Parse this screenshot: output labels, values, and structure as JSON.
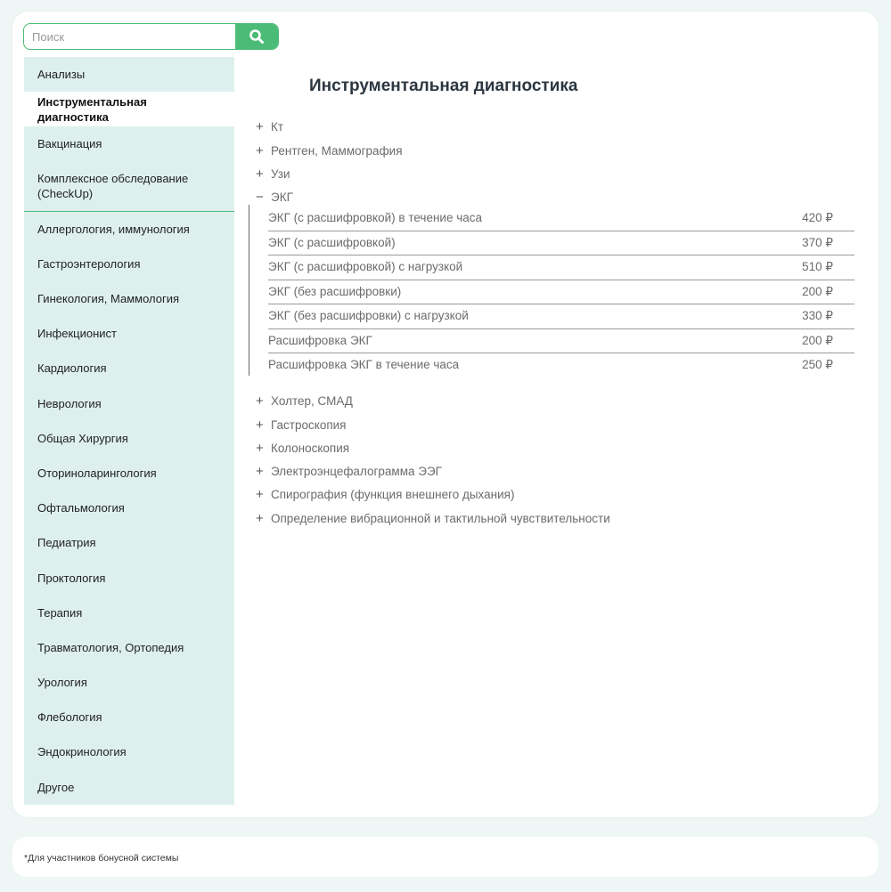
{
  "search": {
    "placeholder": "Поиск"
  },
  "sidebar": {
    "items": [
      {
        "label": "Анализы"
      },
      {
        "label": "Инструментальная диагностика"
      },
      {
        "label": "Вакцинация"
      },
      {
        "label": "Комплексное обследование (CheckUp)"
      },
      {
        "label": "Аллергология, иммунология"
      },
      {
        "label": "Гастроэнтерология"
      },
      {
        "label": "Гинекология, Маммология"
      },
      {
        "label": "Инфекционист"
      },
      {
        "label": "Кардиология"
      },
      {
        "label": "Неврология"
      },
      {
        "label": "Общая Хирургия"
      },
      {
        "label": "Оториноларингология"
      },
      {
        "label": "Офтальмология"
      },
      {
        "label": "Педиатрия"
      },
      {
        "label": "Проктология"
      },
      {
        "label": "Терапия"
      },
      {
        "label": "Травматология, Ортопедия"
      },
      {
        "label": "Урология"
      },
      {
        "label": "Флебология"
      },
      {
        "label": "Эндокринология"
      },
      {
        "label": "Другое"
      }
    ]
  },
  "main": {
    "title": "Инструментальная диагностика",
    "categories": [
      {
        "sign": "+",
        "label": "Кт"
      },
      {
        "sign": "+",
        "label": "Рентген, Маммография"
      },
      {
        "sign": "+",
        "label": "Узи"
      },
      {
        "sign": "−",
        "label": "ЭКГ"
      },
      {
        "sign": "+",
        "label": "Холтер, СМАД"
      },
      {
        "sign": "+",
        "label": "Гастроскопия"
      },
      {
        "sign": "+",
        "label": "Колоноскопия"
      },
      {
        "sign": "+",
        "label": "Электроэнцефалограмма ЭЭГ"
      },
      {
        "sign": "+",
        "label": "Спирография (функция внешнего дыхания)"
      },
      {
        "sign": "+",
        "label": "Определение вибрационной и тактильной чувствительности"
      }
    ],
    "ekg_prices": [
      {
        "name": "ЭКГ (с расшифровкой) в течение часа",
        "price": "420 ₽"
      },
      {
        "name": "ЭКГ (с расшифровкой)",
        "price": "370 ₽"
      },
      {
        "name": "ЭКГ (с расшифровкой) с нагрузкой",
        "price": "510 ₽"
      },
      {
        "name": "ЭКГ (без расшифровки)",
        "price": "200 ₽"
      },
      {
        "name": "ЭКГ (без расшифровки) с нагрузкой",
        "price": "330 ₽"
      },
      {
        "name": "Расшифровка ЭКГ",
        "price": "200 ₽"
      },
      {
        "name": "Расшифровка ЭКГ в течение часа",
        "price": "250 ₽"
      }
    ]
  },
  "footer": {
    "note": "*Для участников бонусной системы"
  },
  "colors": {
    "accent": "#4cbb78",
    "sidebar_bg": "#ddf0ed",
    "page_bg": "#eef7f5"
  },
  "icons": {
    "search": "search-icon"
  }
}
